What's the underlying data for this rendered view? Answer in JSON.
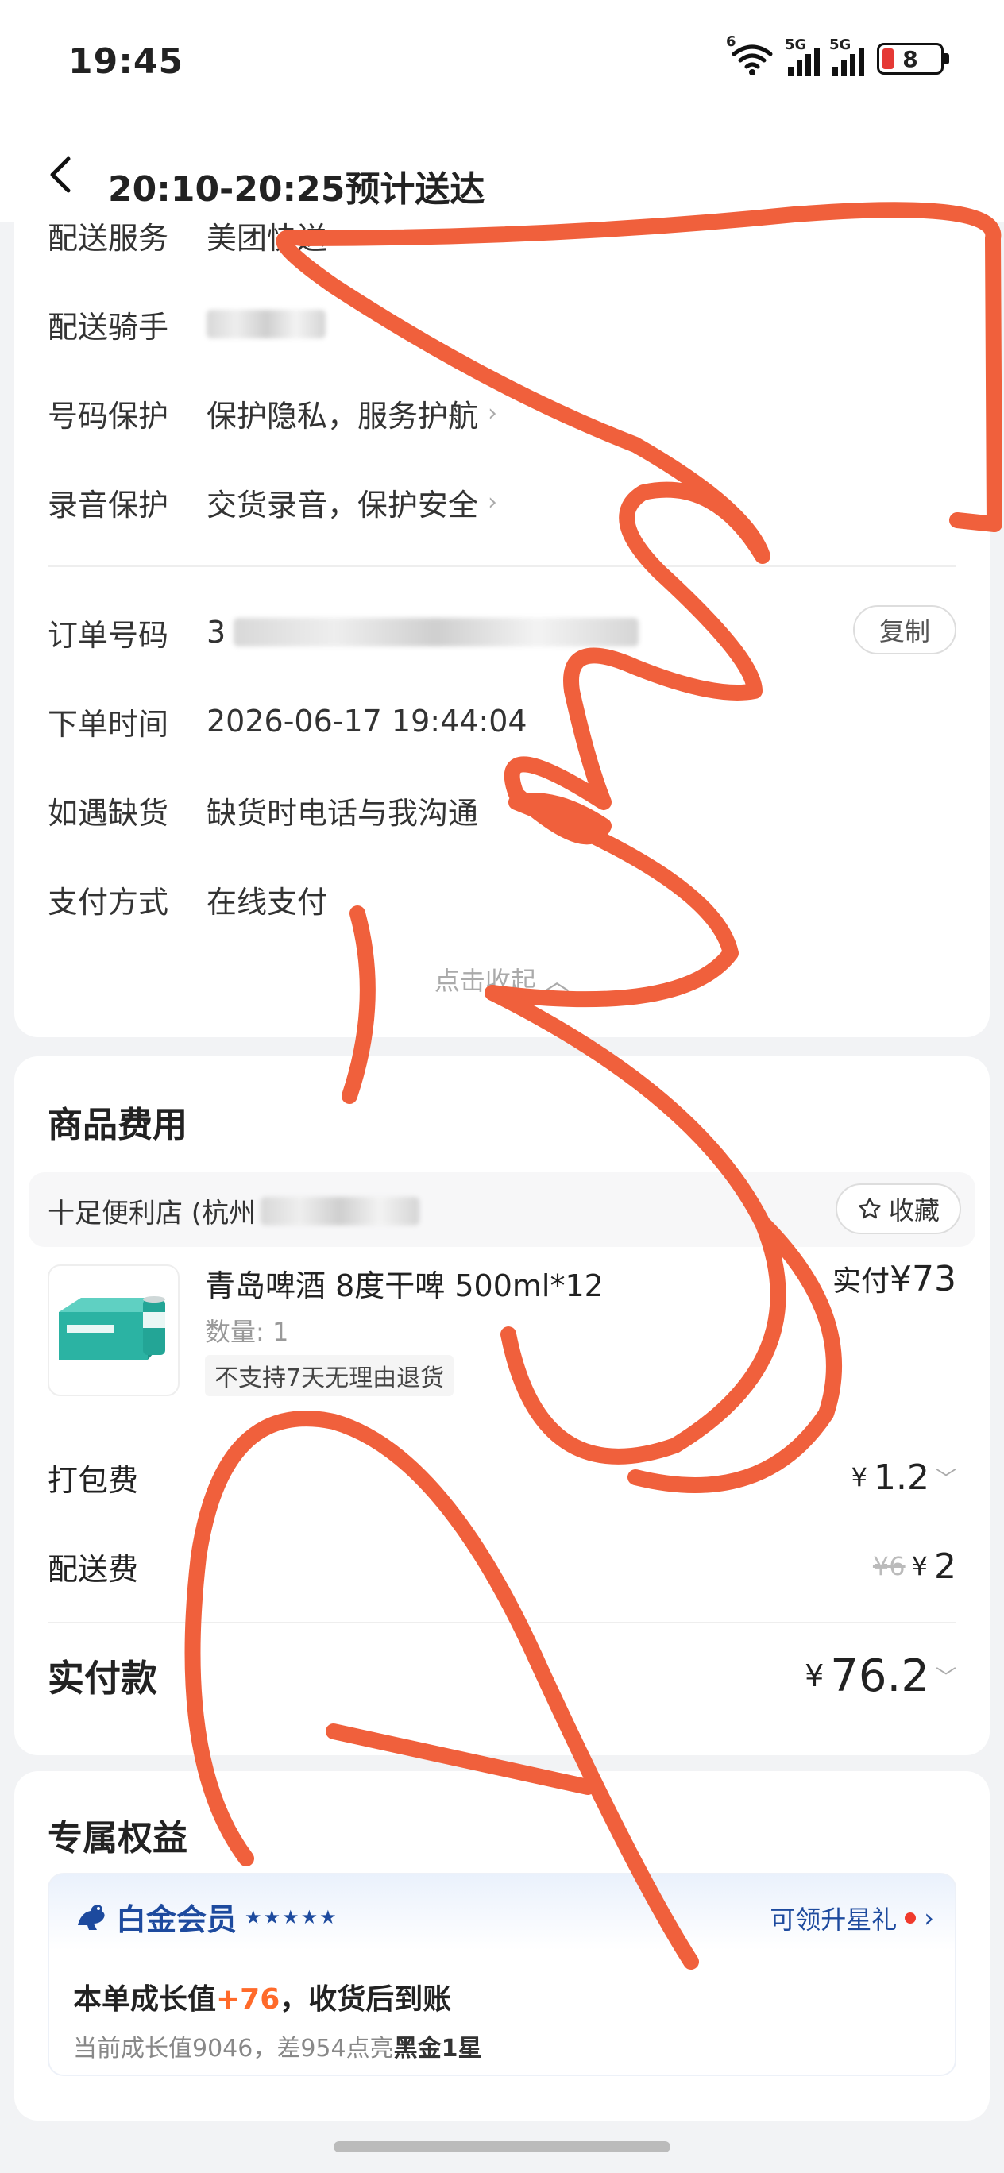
{
  "status_bar": {
    "time": "19:45",
    "network_1": "5G",
    "network_2": "5G",
    "wifi_badge": "6",
    "battery": "8"
  },
  "header": {
    "title": "20:10-20:25预计送达"
  },
  "order_info": {
    "delivery_service_label": "配送服务",
    "delivery_service_value": "美团快送",
    "rider_label": "配送骑手",
    "number_protect_label": "号码保护",
    "number_protect_value": "保护隐私，服务护航",
    "recording_label": "录音保护",
    "recording_value": "交货录音，保护安全",
    "order_no_label": "订单号码",
    "order_no_prefix": "3",
    "copy_label": "复制",
    "order_time_label": "下单时间",
    "order_time_value": "2026-06-17 19:44:04",
    "out_of_stock_label": "如遇缺货",
    "out_of_stock_value": "缺货时电话与我沟通",
    "payment_label": "支付方式",
    "payment_value": "在线支付",
    "collapse_label": "点击收起"
  },
  "goods": {
    "title": "商品费用",
    "store_name": "十足便利店 (杭州",
    "favorite_label": "收藏",
    "product_name": "青岛啤酒 8度干啤 500ml*12",
    "product_qty": "数量: 1",
    "product_tag": "不支持7天无理由退货",
    "product_price_label": "实付",
    "product_price": "¥73",
    "packing_label": "打包费",
    "packing_currency": "¥",
    "packing_amount": "1.2",
    "delivery_fee_label": "配送费",
    "delivery_fee_original": "¥6",
    "delivery_fee_currency": "¥",
    "delivery_fee_amount": "2",
    "total_label": "实付款",
    "total_currency": "¥",
    "total_amount": "76.2"
  },
  "benefits": {
    "title": "专属权益",
    "member_title": "白金会员",
    "member_stars": "★★★★★",
    "upgrade_label": "可领升星礼",
    "growth_prefix": "本单成长值",
    "growth_value": "+76",
    "growth_suffix": "，收货后到账",
    "growth_sub_prefix": "当前成长值9046，差954点亮",
    "growth_sub_bold": "黑金1星"
  },
  "colors": {
    "accent_orange": "#ff6a2a",
    "member_blue": "#1d4a9e",
    "scribble": "#f0603c"
  }
}
